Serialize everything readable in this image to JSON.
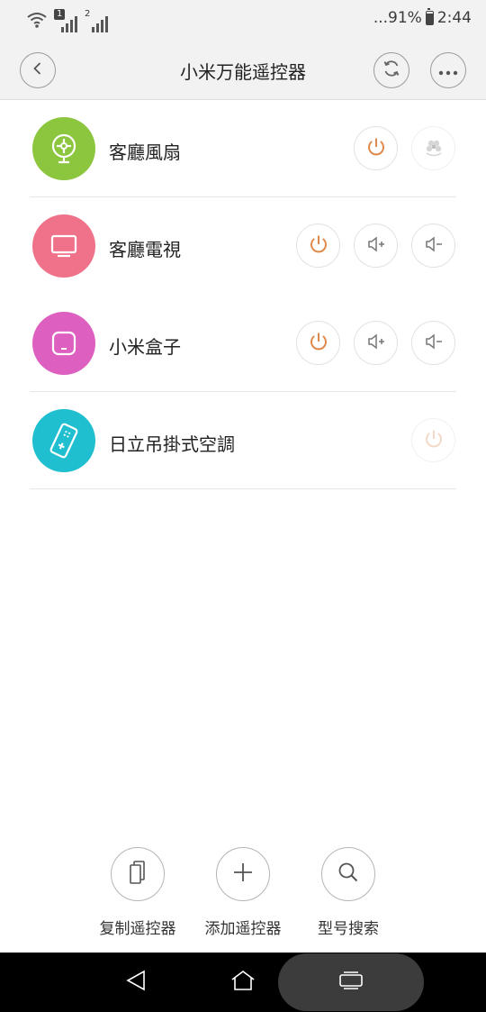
{
  "status": {
    "sim1_label": "1",
    "sim2_label": "2",
    "battery_text": "...91%",
    "time": "2:44"
  },
  "header": {
    "title": "小米万能遥控器",
    "back_icon": "chevron-left-icon",
    "sync_icon": "sync-icon",
    "more_icon": "more-icon"
  },
  "devices": [
    {
      "name": "客廳風扇",
      "color": "#8cc63f",
      "icon": "fan-icon",
      "controls": [
        "power",
        "fan-swing"
      ]
    },
    {
      "name": "客廳電視",
      "color": "#f0728a",
      "icon": "tv-icon",
      "controls": [
        "power",
        "volume-up",
        "volume-down"
      ]
    },
    {
      "name": "小米盒子",
      "color": "#dd5fc0",
      "icon": "tv-box-icon",
      "controls": [
        "power",
        "volume-up",
        "volume-down"
      ]
    },
    {
      "name": "日立吊掛式空調",
      "color": "#1fbfcf",
      "icon": "ac-remote-icon",
      "controls": [
        "power-disabled"
      ]
    }
  ],
  "accent_color": "#e0884a",
  "actions": {
    "copy_label": "复制遥控器",
    "add_label": "添加遥控器",
    "search_label": "型号搜索"
  }
}
